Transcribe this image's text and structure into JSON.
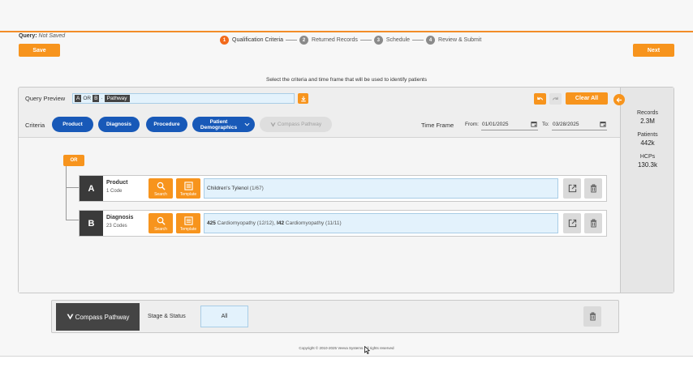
{
  "header": {
    "query_label": "Query:",
    "query_status": "Not Saved",
    "save_label": "Save",
    "next_label": "Next",
    "steps": [
      {
        "num": "1",
        "label": "Qualification Criteria"
      },
      {
        "num": "2",
        "label": "Returned Records"
      },
      {
        "num": "3",
        "label": "Schedule"
      },
      {
        "num": "4",
        "label": "Review & Submit"
      }
    ]
  },
  "subtitle": "Select the criteria and time frame that will be used to identify patients",
  "query_preview": {
    "label": "Query Preview",
    "chip_a": "A",
    "op": "OR",
    "chip_b": "B",
    "chip_path": "Pathway",
    "clear_all_label": "Clear All"
  },
  "criteria": {
    "label": "Criteria",
    "pills": [
      "Product",
      "Diagnosis",
      "Procedure",
      "Patient Demographics"
    ],
    "compass_pill": "Compass Pathway",
    "time_frame_label": "Time Frame",
    "from_label": "From:",
    "from_value": "01/01/2025",
    "to_label": "To:",
    "to_value": "03/28/2025"
  },
  "tree": {
    "operator": "OR",
    "search_label": "Search",
    "template_label": "Template",
    "rows": [
      {
        "letter": "A",
        "name": "Product",
        "count": "1 Code",
        "value_main": "Children's Tylenol",
        "value_detail": "(1/67)"
      },
      {
        "letter": "B",
        "name": "Diagnosis",
        "count": "23 Codes",
        "code1": "425",
        "desc1": "Cardiomyopathy (12/12),",
        "code2": "I42",
        "desc2": "Cardiomyopathy (11/11)"
      }
    ]
  },
  "stats": [
    {
      "label": "Records",
      "value": "2.3M"
    },
    {
      "label": "Patients",
      "value": "442k"
    },
    {
      "label": "HCPs",
      "value": "130.3k"
    }
  ],
  "compass": {
    "brand": "Compass Pathway",
    "stage_label": "Stage & Status",
    "all_label": "All"
  },
  "copyright": "Copyright © 2010-2025 Veeva Systems. All rights reserved",
  "colors": {
    "accent": "#f7941d",
    "pill_blue": "#1859b8",
    "step_active": "#f26a1b",
    "field_blue": "#e3f2fc"
  }
}
